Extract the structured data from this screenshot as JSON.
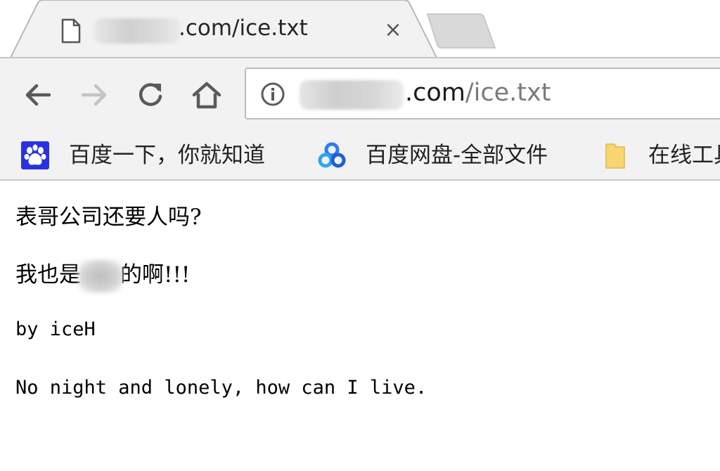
{
  "tab": {
    "title": ".com/ice.txt",
    "close_glyph": "×",
    "icon": "file-icon"
  },
  "toolbar": {
    "back_icon": "back-arrow-icon",
    "forward_icon": "forward-arrow-icon",
    "reload_icon": "reload-icon",
    "home_icon": "home-icon",
    "omnibox": {
      "host_visible": ".com",
      "path": "/ice.txt",
      "info_icon": "info-icon"
    }
  },
  "bookmarks": [
    {
      "label": "百度一下，你就知道",
      "icon": "baidu-paw-icon"
    },
    {
      "label": "百度网盘-全部文件",
      "icon": "baidu-pan-icon"
    },
    {
      "label": "在线工具",
      "icon": "folder-icon"
    }
  ],
  "content": {
    "line1": "表哥公司还要人吗?",
    "line2_before": "我也是",
    "line2_after": "的啊!!!",
    "line3": "by iceH",
    "line4": "No night and lonely, how can I live."
  },
  "colors": {
    "chrome_bg": "#f2f2f2",
    "tab_bg": "#f2f2f2",
    "inactive_tab": "#d9d9d9",
    "page_bg": "#ffffff",
    "baidu_blue": "#2932e1",
    "folder_yellow": "#f7d672"
  }
}
